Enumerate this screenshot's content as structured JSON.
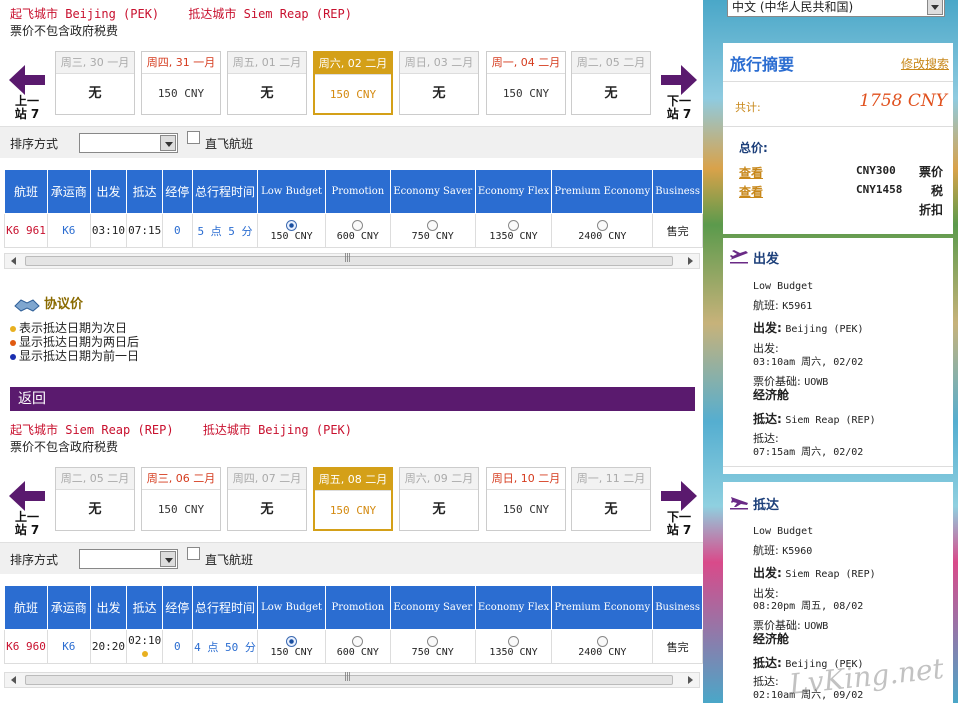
{
  "outbound": {
    "route": {
      "from": "起飞城市 Beijing (PEK)",
      "to": "抵达城市 Siem Reap (REP)"
    },
    "tax_note": "票价不包含政府税费",
    "prev_label": "上一站 7",
    "next_label": "下一站 7",
    "days": [
      {
        "head": "周三, 30 一月",
        "price": "无",
        "highlight": false,
        "selected": false
      },
      {
        "head": "周四, 31 一月",
        "price": "150 CNY",
        "highlight": true,
        "selected": false
      },
      {
        "head": "周五, 01 二月",
        "price": "无",
        "highlight": false,
        "selected": false
      },
      {
        "head": "周六, 02 二月",
        "price": "150 CNY",
        "highlight": false,
        "selected": true
      },
      {
        "head": "周日, 03 二月",
        "price": "无",
        "highlight": false,
        "selected": false
      },
      {
        "head": "周一, 04 二月",
        "price": "150 CNY",
        "highlight": true,
        "selected": false
      },
      {
        "head": "周二, 05 二月",
        "price": "无",
        "highlight": false,
        "selected": false
      }
    ],
    "sort_label": "排序方式",
    "direct_label": "直飞航班",
    "flight": {
      "flight_no": "K6 961",
      "carrier": "K6",
      "depart": "03:10",
      "arrive": "07:15",
      "stops": "0",
      "duration": "5 点 5 分",
      "fares": [
        "150 CNY",
        "600 CNY",
        "750 CNY",
        "1350 CNY",
        "2400 CNY"
      ],
      "sold_out": "售完"
    }
  },
  "table_headers": {
    "flight": "航班",
    "carrier": "承运商",
    "depart": "出发",
    "arrive": "抵达",
    "stops": "经停",
    "duration": "总行程时间",
    "fares": [
      "Low Budget",
      "Promotion",
      "Economy Saver",
      "Economy Flex",
      "Premium Economy",
      "Business"
    ]
  },
  "legend": {
    "title": "协议价",
    "items": [
      {
        "text": "表示抵达日期为次日",
        "color": "#e8b020"
      },
      {
        "text": "显示抵达日期为两日后",
        "color": "#e05a10"
      },
      {
        "text": "显示抵达日期为前一日",
        "color": "#1a2fb0"
      }
    ]
  },
  "return_title": "返回",
  "inbound": {
    "route": {
      "from": "起飞城市 Siem Reap (REP)",
      "to": "抵达城市 Beijing (PEK)"
    },
    "tax_note": "票价不包含政府税费",
    "prev_label": "上一站 7",
    "next_label": "下一站 7",
    "days": [
      {
        "head": "周二, 05 二月",
        "price": "无",
        "highlight": false,
        "selected": false
      },
      {
        "head": "周三, 06 二月",
        "price": "150 CNY",
        "highlight": true,
        "selected": false
      },
      {
        "head": "周四, 07 二月",
        "price": "无",
        "highlight": false,
        "selected": false
      },
      {
        "head": "周五, 08 二月",
        "price": "150 CNY",
        "highlight": false,
        "selected": true
      },
      {
        "head": "周六, 09 二月",
        "price": "无",
        "highlight": false,
        "selected": false
      },
      {
        "head": "周日, 10 二月",
        "price": "150 CNY",
        "highlight": true,
        "selected": false
      },
      {
        "head": "周一, 11 二月",
        "price": "无",
        "highlight": false,
        "selected": false
      }
    ],
    "sort_label": "排序方式",
    "direct_label": "直飞航班",
    "flight": {
      "flight_no": "K6 960",
      "carrier": "K6",
      "depart": "20:20",
      "arrive": "02:10",
      "stops": "0",
      "duration": "4 点 50 分",
      "fares": [
        "150 CNY",
        "600 CNY",
        "750 CNY",
        "1350 CNY",
        "2400 CNY"
      ],
      "sold_out": "售完"
    }
  },
  "sidebar": {
    "language": "中文 (中华人民共和国)",
    "summary_title": "旅行摘要",
    "edit_search": "修改搜索",
    "total_label": "共计:",
    "total_value": "1758 CNY",
    "price_label": "总价:",
    "view_label": "查看",
    "fare_amount": "CNY300",
    "fare_kind": "票价",
    "tax_amount": "CNY1458",
    "tax_kind": "税",
    "discount": "折扣",
    "depart_seg": {
      "title": "出发",
      "fare_class": "Low Budget",
      "flight_label": "航班:",
      "flight": "K5961",
      "depart_label": "出发:",
      "depart_city": "Beijing (PEK)",
      "depart_time_label": "出发:",
      "depart_time": "03:10am 周六, 02/02",
      "fare_basis_label": "票价基础:",
      "fare_basis": "UOWB",
      "cabin": "经济舱",
      "arrive_label": "抵达:",
      "arrive_city": "Siem Reap (REP)",
      "arrive_time_label": "抵达:",
      "arrive_time": "07:15am 周六, 02/02"
    },
    "arrive_seg": {
      "title": "抵达",
      "fare_class": "Low Budget",
      "flight_label": "航班:",
      "flight": "K5960",
      "depart_label": "出发:",
      "depart_city": "Siem Reap (REP)",
      "depart_time_label": "出发:",
      "depart_time": "08:20pm 周五, 08/02",
      "fare_basis_label": "票价基础:",
      "fare_basis": "UOWB",
      "cabin": "经济舱",
      "arrive_label": "抵达:",
      "arrive_city": "Beijing (PEK)",
      "arrive_time_label": "抵达:",
      "arrive_time": "02:10am 周六, 09/02"
    }
  },
  "watermark": "LvKing.net",
  "colors": {
    "accent_blue": "#2b6dd1",
    "purple_bar": "#5a1a6e",
    "gold_selected": "#d4a018",
    "route_red": "#c8102e",
    "total_orange": "#e0511e"
  }
}
